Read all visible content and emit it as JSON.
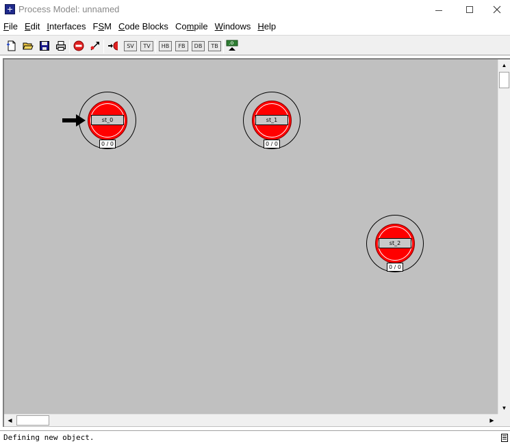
{
  "window": {
    "title": "Process Model: unnamed",
    "icon": "star-app-icon"
  },
  "menu": {
    "items": [
      {
        "pre": "",
        "u": "F",
        "post": "ile"
      },
      {
        "pre": "",
        "u": "E",
        "post": "dit"
      },
      {
        "pre": "",
        "u": "I",
        "post": "nterfaces"
      },
      {
        "pre": "F",
        "u": "S",
        "post": "M"
      },
      {
        "pre": "",
        "u": "C",
        "post": "ode Blocks"
      },
      {
        "pre": "Co",
        "u": "m",
        "post": "pile"
      },
      {
        "pre": "",
        "u": "W",
        "post": "indows"
      },
      {
        "pre": "",
        "u": "H",
        "post": "elp"
      }
    ]
  },
  "toolbar": {
    "sv": "SV",
    "tv": "TV",
    "hb": "HB",
    "fb": "FB",
    "db": "DB",
    "tb": "TB",
    "compile_badge": ".o"
  },
  "states": [
    {
      "name": "st_0",
      "counter": "0 / 0",
      "initial": true
    },
    {
      "name": "st_1",
      "counter": "0 / 0",
      "initial": false
    },
    {
      "name": "st_2",
      "counter": "0 / 0",
      "initial": false
    }
  ],
  "status": {
    "message": "Defining new object."
  },
  "colors": {
    "state_fill": "#ff0000",
    "canvas_bg": "#c0c0c0"
  }
}
